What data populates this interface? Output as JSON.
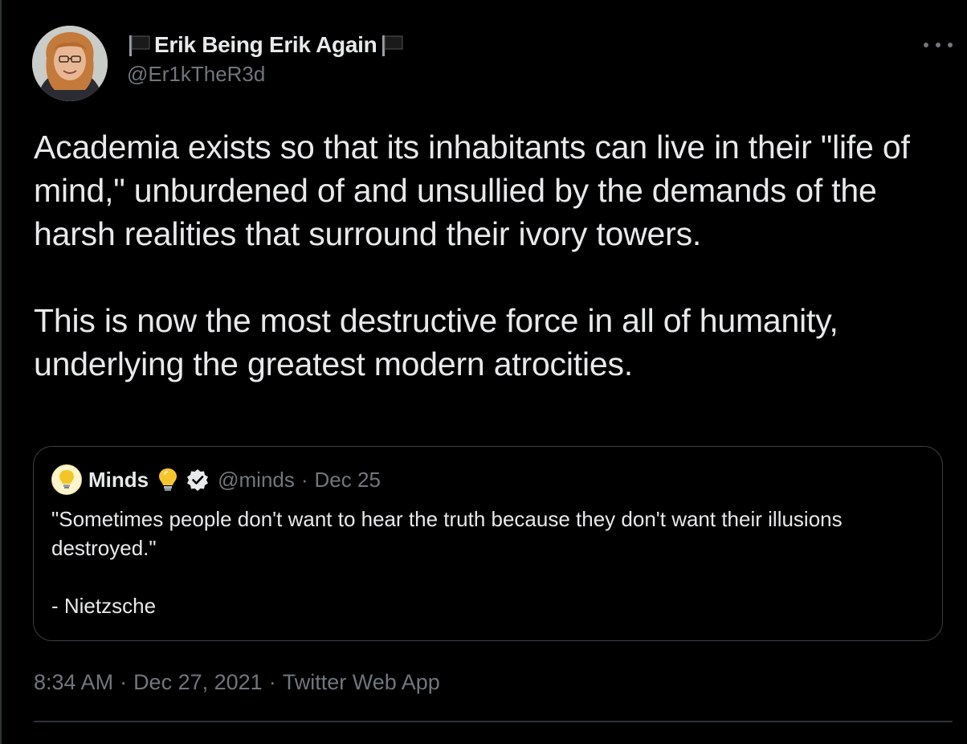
{
  "tweet": {
    "author": {
      "display_name": "Erik Being Erik Again",
      "handle": "@Er1kTheR3d",
      "flag_icon": "black-flag-icon"
    },
    "text_paragraphs": [
      "Academia exists so that its inhabitants can live in their \"life of mind,\" unburdened of and unsullied by the demands of the harsh realities that surround their ivory towers.",
      "This is now the most destructive force in all of humanity, underlying the greatest modern atrocities."
    ],
    "quoted": {
      "name": "Minds",
      "name_emoji": "light-bulb-icon",
      "verified": true,
      "handle": "@minds",
      "separator": "·",
      "date": "Dec 25",
      "text_paragraphs": [
        "\"Sometimes people don't want to hear the truth because they don't want their illusions destroyed.\"",
        "- Nietzsche"
      ]
    },
    "meta": {
      "time": "8:34 AM",
      "separator": "·",
      "date": "Dec 27, 2021",
      "source": "Twitter Web App"
    }
  },
  "colors": {
    "background": "#000000",
    "text_primary": "#e7e9ea",
    "text_secondary": "#71767b",
    "border": "#2f3336"
  }
}
